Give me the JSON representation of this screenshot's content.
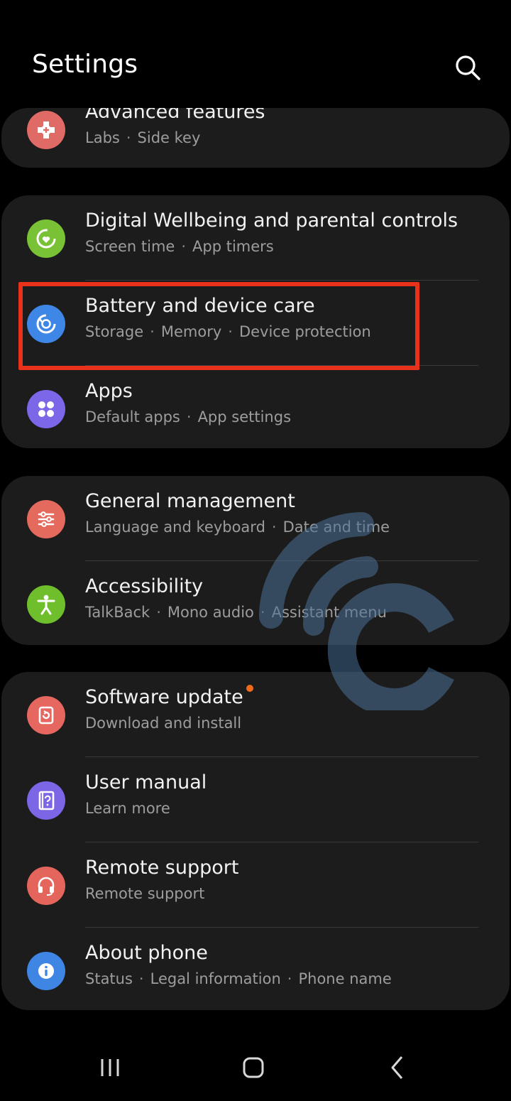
{
  "header": {
    "title": "Settings",
    "search_icon": "search-icon"
  },
  "colors": {
    "background": "#000000",
    "card": "#1c1c1c",
    "highlight": "#e8321c",
    "notification": "#f26a1b",
    "watermark": "#4b6f96"
  },
  "sections": [
    {
      "items": [
        {
          "id": "advanced-features",
          "title": "Advanced features",
          "subs": [
            "Labs",
            "Side key"
          ],
          "icon": "puzzle-plus-icon",
          "icon_color": "#e06a66"
        }
      ]
    },
    {
      "items": [
        {
          "id": "digital-wellbeing",
          "title": "Digital Wellbeing and parental controls",
          "subs": [
            "Screen time",
            "App timers"
          ],
          "icon": "wellbeing-heart-icon",
          "icon_color": "#7ac235"
        },
        {
          "id": "battery-device-care",
          "title": "Battery and device care",
          "subs": [
            "Storage",
            "Memory",
            "Device protection"
          ],
          "icon": "device-care-icon",
          "icon_color": "#3f87e6"
        },
        {
          "id": "apps",
          "title": "Apps",
          "subs": [
            "Default apps",
            "App settings"
          ],
          "icon": "apps-grid-icon",
          "icon_color": "#7b67e8"
        }
      ]
    },
    {
      "items": [
        {
          "id": "general-management",
          "title": "General management",
          "subs": [
            "Language and keyboard",
            "Date and time"
          ],
          "icon": "sliders-icon",
          "icon_color": "#e56a5e"
        },
        {
          "id": "accessibility",
          "title": "Accessibility",
          "subs": [
            "TalkBack",
            "Mono audio",
            "Assistant menu"
          ],
          "icon": "accessibility-person-icon",
          "icon_color": "#6fbf2c"
        }
      ]
    },
    {
      "items": [
        {
          "id": "software-update",
          "title": "Software update",
          "subs": [
            "Download and install"
          ],
          "icon": "software-update-icon",
          "icon_color": "#e5675f",
          "badge": true
        },
        {
          "id": "user-manual",
          "title": "User manual",
          "subs": [
            "Learn more"
          ],
          "icon": "manual-question-icon",
          "icon_color": "#7c66e6"
        },
        {
          "id": "remote-support",
          "title": "Remote support",
          "subs": [
            "Remote support"
          ],
          "icon": "headset-icon",
          "icon_color": "#e3655c"
        },
        {
          "id": "about-phone",
          "title": "About phone",
          "subs": [
            "Status",
            "Legal information",
            "Phone name"
          ],
          "icon": "info-icon",
          "icon_color": "#3f86e4"
        }
      ]
    }
  ],
  "highlighted_item": "battery-device-care",
  "navbar": {
    "recents_icon": "recents-icon",
    "home_icon": "home-icon",
    "back_icon": "back-icon"
  }
}
